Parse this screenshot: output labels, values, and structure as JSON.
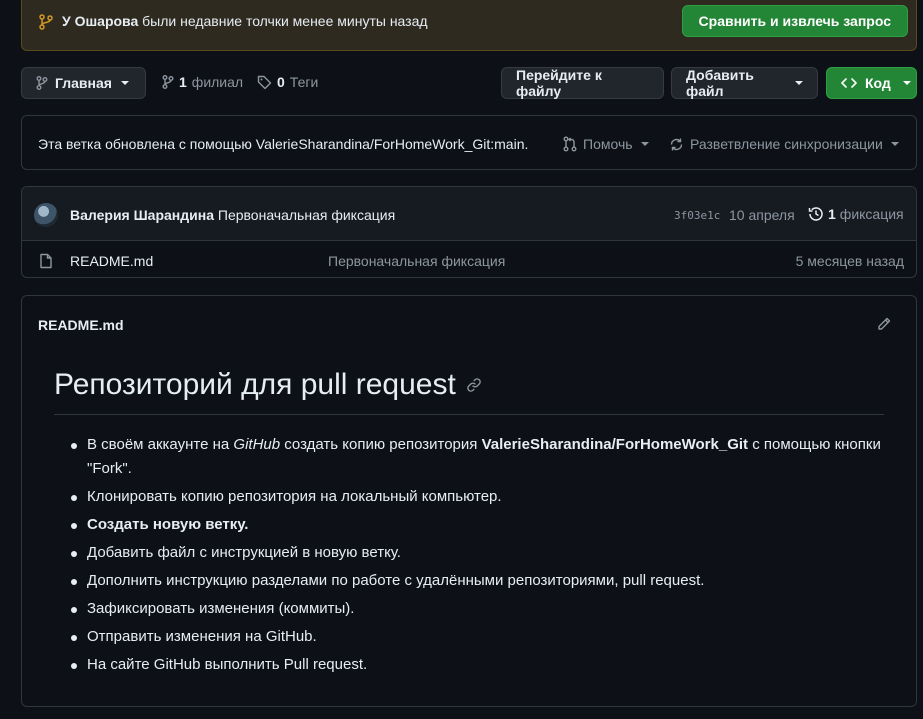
{
  "banner": {
    "user": "У Ошарова",
    "message": " были недавние толчки менее минуты назад",
    "compare_button": "Сравнить и извлечь запрос"
  },
  "toolbar": {
    "branch_label": "Главная",
    "branches_count": "1",
    "branches_label": "филиал",
    "tags_count": "0",
    "tags_label": "Теги",
    "go_to_file": "Перейдите к файлу",
    "add_file": "Добавить файл",
    "code": "Код"
  },
  "sync": {
    "status": "Эта ветка обновлена с помощью ValerieSharandina/ForHomeWork_Git:main.",
    "contribute": "Помочь",
    "sync_fork": "Разветвление синхронизации"
  },
  "commit": {
    "author": "Валерия Шарандина",
    "message": "Первоначальная фиксация",
    "sha": "3f03e1c",
    "date": "10 апреля",
    "count": "1",
    "count_label": "фиксация"
  },
  "files": [
    {
      "name": "README.md",
      "message": "Первоначальная фиксация",
      "age": "5 месяцев назад"
    }
  ],
  "readme": {
    "filename": "README.md",
    "heading": "Репозиторий для pull request",
    "items": {
      "i1_a": "В своём аккаунте на ",
      "i1_b": "GitHub",
      "i1_c": " создать копию репозитория ",
      "i1_d": "ValerieSharandina/ForHomeWork_Git",
      "i1_e": " с помощью кнопки \"Fork\".",
      "i2": "Клонировать копию репозитория на локальный компьютер.",
      "i3": "Создать новую ветку.",
      "i4": "Добавить файл с инструкцией в новую ветку.",
      "i5": "Дополнить инструкцию разделами по работе с удалёнными репозиториями, pull request.",
      "i6": "Зафиксировать изменения (коммиты).",
      "i7": "Отправить изменения на GitHub.",
      "i8": "На сайте GitHub выполнить Pull request."
    }
  },
  "colors": {
    "background": "#0d1117",
    "border": "#30363d",
    "accent_green": "#238636",
    "banner_bg": "#2e2a1f",
    "muted": "#8d96a0"
  }
}
